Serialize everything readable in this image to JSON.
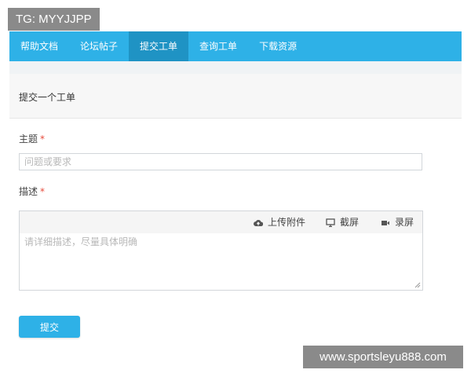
{
  "watermarks": {
    "top_left": "TG: MYYJJPP",
    "bottom_right": "www.sportsleyu888.com"
  },
  "nav": {
    "items": [
      {
        "label": "帮助文档"
      },
      {
        "label": "论坛帖子"
      },
      {
        "label": "提交工单",
        "active": true
      },
      {
        "label": "查询工单"
      },
      {
        "label": "下载资源"
      }
    ],
    "active_color": "#1f93c4",
    "bar_color": "#2eb1e7"
  },
  "panel": {
    "title": "提交一个工单"
  },
  "form": {
    "subject": {
      "label": "主题",
      "required_mark": "*",
      "placeholder": "问题或要求",
      "value": ""
    },
    "description": {
      "label": "描述",
      "required_mark": "*",
      "placeholder": "请详细描述，尽量具体明确",
      "toolbar": {
        "upload": {
          "label": "上传附件",
          "icon": "cloud-upload-icon"
        },
        "screenshot": {
          "label": "截屏",
          "icon": "monitor-icon"
        },
        "record": {
          "label": "录屏",
          "icon": "video-camera-icon"
        }
      }
    },
    "submit_label": "提交"
  }
}
